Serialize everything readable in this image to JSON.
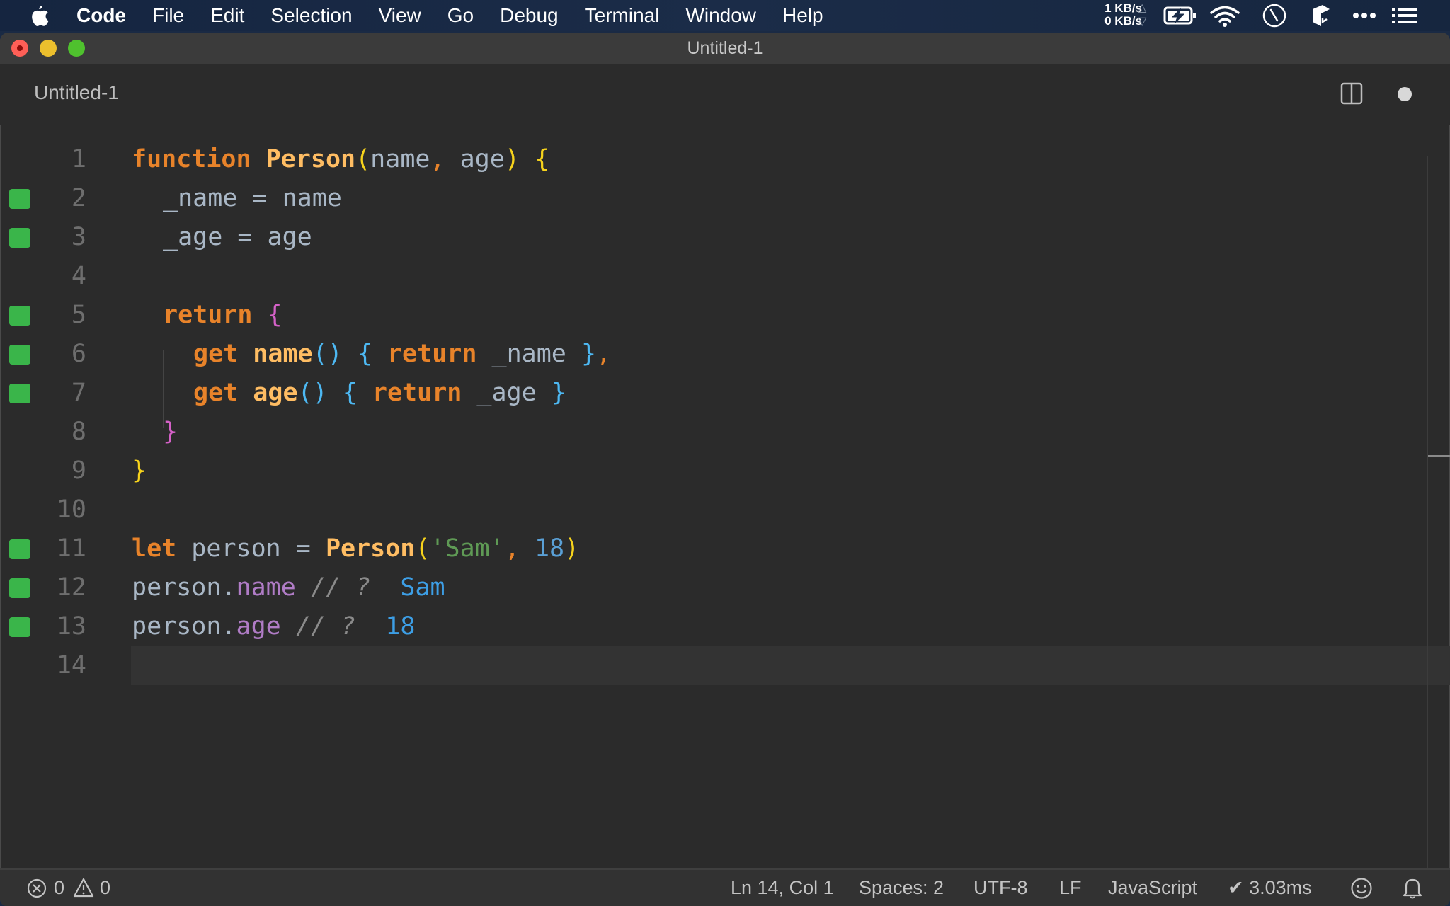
{
  "menubar": {
    "app_name": "Code",
    "items": [
      "File",
      "Edit",
      "Selection",
      "View",
      "Go",
      "Debug",
      "Terminal",
      "Window",
      "Help"
    ],
    "net_up": "1 KB/s",
    "net_down": "0 KB/s",
    "icons": [
      "apple-icon",
      "network-speed-icon",
      "battery-charging-icon",
      "wifi-icon",
      "clock-icon",
      "box-icon",
      "more-icon",
      "list-icon"
    ]
  },
  "window": {
    "title": "Untitled-1"
  },
  "tab": {
    "label": "Untitled-1",
    "dirty": true
  },
  "editor": {
    "current_line": 14,
    "lines": [
      {
        "n": "1",
        "marker": false
      },
      {
        "n": "2",
        "marker": true
      },
      {
        "n": "3",
        "marker": true
      },
      {
        "n": "4",
        "marker": false
      },
      {
        "n": "5",
        "marker": true
      },
      {
        "n": "6",
        "marker": true
      },
      {
        "n": "7",
        "marker": true
      },
      {
        "n": "8",
        "marker": false
      },
      {
        "n": "9",
        "marker": false
      },
      {
        "n": "10",
        "marker": false
      },
      {
        "n": "11",
        "marker": true
      },
      {
        "n": "12",
        "marker": true
      },
      {
        "n": "13",
        "marker": true
      },
      {
        "n": "14",
        "marker": false
      }
    ],
    "tokens": {
      "l1": [
        "function",
        " ",
        "Person",
        "(",
        "name",
        ", ",
        "age",
        ")",
        " ",
        "{"
      ],
      "l2": [
        "_name",
        " = ",
        "name"
      ],
      "l3": [
        "_age",
        " = ",
        "age"
      ],
      "l5": [
        "return",
        " ",
        "{"
      ],
      "l6": [
        "get",
        " ",
        "name",
        "()",
        " ",
        "{",
        " ",
        "return",
        " ",
        "_name",
        " ",
        "}",
        ","
      ],
      "l7": [
        "get",
        " ",
        "age",
        "()",
        " ",
        "{",
        " ",
        "return",
        " ",
        "_age",
        " ",
        "}"
      ],
      "l8": [
        "}"
      ],
      "l9": [
        "}"
      ],
      "l11": [
        "let",
        " ",
        "person",
        " = ",
        "Person",
        "(",
        "'Sam'",
        ", ",
        "18",
        ")"
      ],
      "l12": [
        "person.",
        "name",
        " ",
        "// ?",
        "  ",
        "Sam"
      ],
      "l13": [
        "person.",
        "age",
        " ",
        "// ?",
        "  ",
        "18"
      ]
    }
  },
  "statusbar": {
    "errors": "0",
    "warnings": "0",
    "cursor": "Ln 14, Col 1",
    "indent": "Spaces: 2",
    "encoding": "UTF-8",
    "eol": "LF",
    "language": "JavaScript",
    "timing": "✔ 3.03ms"
  }
}
